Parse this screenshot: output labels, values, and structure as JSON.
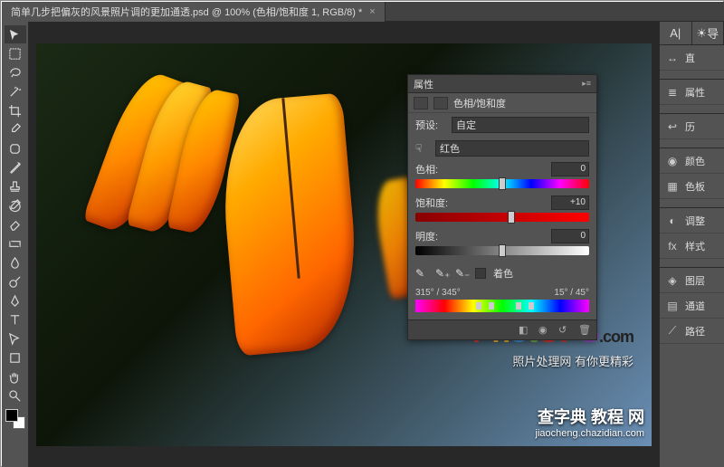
{
  "tab": {
    "title": "简单几步把偏灰的风景照片调的更加通透.psd @ 100% (色相/饱和度 1, RGB/8) *"
  },
  "panel": {
    "title": "属性",
    "adjustment_name": "色相/饱和度",
    "preset_label": "预设:",
    "preset_value": "自定",
    "channel_value": "红色",
    "hue_label": "色相:",
    "hue_value": "0",
    "sat_label": "饱和度:",
    "sat_value": "+10",
    "lit_label": "明度:",
    "lit_value": "0",
    "colorize_label": "着色",
    "range_left": "315° / 345°",
    "range_right": "15° / 45°"
  },
  "right": {
    "char": "A|",
    "guide": "导",
    "line": "直",
    "props": "属性",
    "history": "历",
    "color": "颜色",
    "swatches": "色板",
    "adjust": "调整",
    "styles": "样式",
    "layers": "图层",
    "channels": "通道",
    "paths": "路径"
  },
  "watermark": {
    "sub": "照片处理网 有你更精彩",
    "site_top": "查字典 教程 网",
    "site_bottom": "jiaocheng.chazidian.com"
  }
}
